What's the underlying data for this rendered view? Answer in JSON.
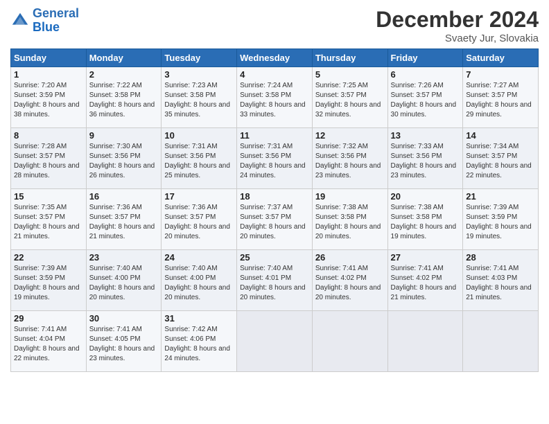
{
  "header": {
    "logo_line1": "General",
    "logo_line2": "Blue",
    "month_title": "December 2024",
    "location": "Svaety Jur, Slovakia"
  },
  "weekdays": [
    "Sunday",
    "Monday",
    "Tuesday",
    "Wednesday",
    "Thursday",
    "Friday",
    "Saturday"
  ],
  "weeks": [
    [
      {
        "day": "1",
        "sunrise": "Sunrise: 7:20 AM",
        "sunset": "Sunset: 3:59 PM",
        "daylight": "Daylight: 8 hours and 38 minutes."
      },
      {
        "day": "2",
        "sunrise": "Sunrise: 7:22 AM",
        "sunset": "Sunset: 3:58 PM",
        "daylight": "Daylight: 8 hours and 36 minutes."
      },
      {
        "day": "3",
        "sunrise": "Sunrise: 7:23 AM",
        "sunset": "Sunset: 3:58 PM",
        "daylight": "Daylight: 8 hours and 35 minutes."
      },
      {
        "day": "4",
        "sunrise": "Sunrise: 7:24 AM",
        "sunset": "Sunset: 3:58 PM",
        "daylight": "Daylight: 8 hours and 33 minutes."
      },
      {
        "day": "5",
        "sunrise": "Sunrise: 7:25 AM",
        "sunset": "Sunset: 3:57 PM",
        "daylight": "Daylight: 8 hours and 32 minutes."
      },
      {
        "day": "6",
        "sunrise": "Sunrise: 7:26 AM",
        "sunset": "Sunset: 3:57 PM",
        "daylight": "Daylight: 8 hours and 30 minutes."
      },
      {
        "day": "7",
        "sunrise": "Sunrise: 7:27 AM",
        "sunset": "Sunset: 3:57 PM",
        "daylight": "Daylight: 8 hours and 29 minutes."
      }
    ],
    [
      {
        "day": "8",
        "sunrise": "Sunrise: 7:28 AM",
        "sunset": "Sunset: 3:57 PM",
        "daylight": "Daylight: 8 hours and 28 minutes."
      },
      {
        "day": "9",
        "sunrise": "Sunrise: 7:30 AM",
        "sunset": "Sunset: 3:56 PM",
        "daylight": "Daylight: 8 hours and 26 minutes."
      },
      {
        "day": "10",
        "sunrise": "Sunrise: 7:31 AM",
        "sunset": "Sunset: 3:56 PM",
        "daylight": "Daylight: 8 hours and 25 minutes."
      },
      {
        "day": "11",
        "sunrise": "Sunrise: 7:31 AM",
        "sunset": "Sunset: 3:56 PM",
        "daylight": "Daylight: 8 hours and 24 minutes."
      },
      {
        "day": "12",
        "sunrise": "Sunrise: 7:32 AM",
        "sunset": "Sunset: 3:56 PM",
        "daylight": "Daylight: 8 hours and 23 minutes."
      },
      {
        "day": "13",
        "sunrise": "Sunrise: 7:33 AM",
        "sunset": "Sunset: 3:56 PM",
        "daylight": "Daylight: 8 hours and 23 minutes."
      },
      {
        "day": "14",
        "sunrise": "Sunrise: 7:34 AM",
        "sunset": "Sunset: 3:57 PM",
        "daylight": "Daylight: 8 hours and 22 minutes."
      }
    ],
    [
      {
        "day": "15",
        "sunrise": "Sunrise: 7:35 AM",
        "sunset": "Sunset: 3:57 PM",
        "daylight": "Daylight: 8 hours and 21 minutes."
      },
      {
        "day": "16",
        "sunrise": "Sunrise: 7:36 AM",
        "sunset": "Sunset: 3:57 PM",
        "daylight": "Daylight: 8 hours and 21 minutes."
      },
      {
        "day": "17",
        "sunrise": "Sunrise: 7:36 AM",
        "sunset": "Sunset: 3:57 PM",
        "daylight": "Daylight: 8 hours and 20 minutes."
      },
      {
        "day": "18",
        "sunrise": "Sunrise: 7:37 AM",
        "sunset": "Sunset: 3:57 PM",
        "daylight": "Daylight: 8 hours and 20 minutes."
      },
      {
        "day": "19",
        "sunrise": "Sunrise: 7:38 AM",
        "sunset": "Sunset: 3:58 PM",
        "daylight": "Daylight: 8 hours and 20 minutes."
      },
      {
        "day": "20",
        "sunrise": "Sunrise: 7:38 AM",
        "sunset": "Sunset: 3:58 PM",
        "daylight": "Daylight: 8 hours and 19 minutes."
      },
      {
        "day": "21",
        "sunrise": "Sunrise: 7:39 AM",
        "sunset": "Sunset: 3:59 PM",
        "daylight": "Daylight: 8 hours and 19 minutes."
      }
    ],
    [
      {
        "day": "22",
        "sunrise": "Sunrise: 7:39 AM",
        "sunset": "Sunset: 3:59 PM",
        "daylight": "Daylight: 8 hours and 19 minutes."
      },
      {
        "day": "23",
        "sunrise": "Sunrise: 7:40 AM",
        "sunset": "Sunset: 4:00 PM",
        "daylight": "Daylight: 8 hours and 20 minutes."
      },
      {
        "day": "24",
        "sunrise": "Sunrise: 7:40 AM",
        "sunset": "Sunset: 4:00 PM",
        "daylight": "Daylight: 8 hours and 20 minutes."
      },
      {
        "day": "25",
        "sunrise": "Sunrise: 7:40 AM",
        "sunset": "Sunset: 4:01 PM",
        "daylight": "Daylight: 8 hours and 20 minutes."
      },
      {
        "day": "26",
        "sunrise": "Sunrise: 7:41 AM",
        "sunset": "Sunset: 4:02 PM",
        "daylight": "Daylight: 8 hours and 20 minutes."
      },
      {
        "day": "27",
        "sunrise": "Sunrise: 7:41 AM",
        "sunset": "Sunset: 4:02 PM",
        "daylight": "Daylight: 8 hours and 21 minutes."
      },
      {
        "day": "28",
        "sunrise": "Sunrise: 7:41 AM",
        "sunset": "Sunset: 4:03 PM",
        "daylight": "Daylight: 8 hours and 21 minutes."
      }
    ],
    [
      {
        "day": "29",
        "sunrise": "Sunrise: 7:41 AM",
        "sunset": "Sunset: 4:04 PM",
        "daylight": "Daylight: 8 hours and 22 minutes."
      },
      {
        "day": "30",
        "sunrise": "Sunrise: 7:41 AM",
        "sunset": "Sunset: 4:05 PM",
        "daylight": "Daylight: 8 hours and 23 minutes."
      },
      {
        "day": "31",
        "sunrise": "Sunrise: 7:42 AM",
        "sunset": "Sunset: 4:06 PM",
        "daylight": "Daylight: 8 hours and 24 minutes."
      },
      null,
      null,
      null,
      null
    ]
  ]
}
